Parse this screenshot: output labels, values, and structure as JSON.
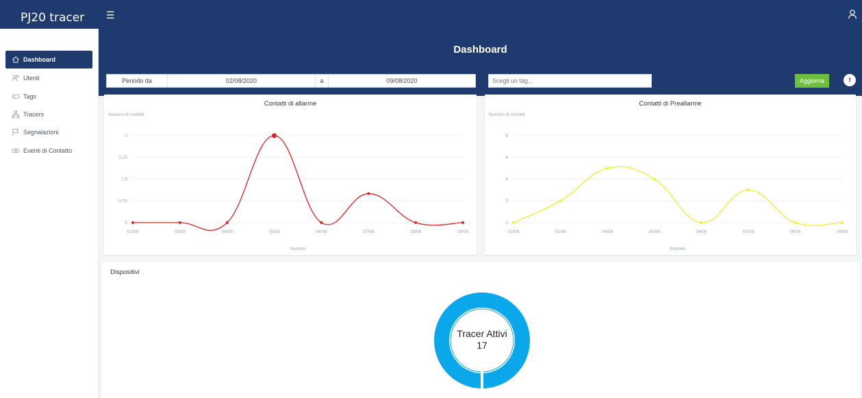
{
  "app": {
    "brand": "PJ20 tracer"
  },
  "colors": {
    "primary": "#1f3a6e",
    "alarm": "#e02020",
    "prealarm": "#f1ee2a",
    "update": "#6fbf3e",
    "donut": "#0aa8ea"
  },
  "icons": {
    "menu": "hamburger-icon",
    "user": "user-icon",
    "info": "info-icon"
  },
  "sidebar": {
    "items": [
      {
        "label": "Dashboard",
        "icon": "home-icon",
        "active": true
      },
      {
        "label": "Utenti",
        "icon": "users-icon",
        "active": false
      },
      {
        "label": "Tags",
        "icon": "tag-icon",
        "active": false
      },
      {
        "label": "Tracers",
        "icon": "network-icon",
        "active": false
      },
      {
        "label": "Segnalazioni",
        "icon": "flag-icon",
        "active": false
      },
      {
        "label": "Eventi di Contatto",
        "icon": "contact-icon",
        "active": false
      }
    ]
  },
  "header": {
    "title": "Dashboard"
  },
  "filters": {
    "period_label": "Periodo da",
    "date_from": "02/08/2020",
    "to_label": "a",
    "date_to": "09/08/2020",
    "tag_placeholder": "Scegli un tag...",
    "update_label": "Aggiorna",
    "info_glyph": "!"
  },
  "chart_data": [
    {
      "type": "line",
      "title": "Contatti di allarme",
      "ylabel": "Numero di contatti",
      "xlabel": "Periodo",
      "categories": [
        "02/08",
        "03/08",
        "04/08",
        "05/08",
        "06/08",
        "07/08",
        "08/08",
        "09/08"
      ],
      "yticks": [
        "0",
        "0.75",
        "1.5",
        "2.25",
        "3"
      ],
      "ylim": [
        0,
        3
      ],
      "values": [
        0,
        0,
        0,
        3,
        0,
        1,
        0,
        0
      ],
      "color": "#e02020",
      "grid": true
    },
    {
      "type": "line",
      "title": "Contatti di Preallarme",
      "ylabel": "Numero di contatti",
      "xlabel": "Periodo",
      "categories": [
        "02/08",
        "03/08",
        "04/08",
        "05/08",
        "06/08",
        "07/08",
        "08/08",
        "09/08"
      ],
      "yticks": [
        "0",
        "2",
        "4",
        "6",
        "8"
      ],
      "ylim": [
        0,
        8
      ],
      "values": [
        0,
        2,
        5,
        4,
        0,
        3,
        0,
        0
      ],
      "color": "#f1ee2a",
      "grid": true
    }
  ],
  "devices": {
    "title": "Dispositivi",
    "donut_label": "Tracer Attivi",
    "active_count": "17",
    "active_fraction": 1.0
  }
}
